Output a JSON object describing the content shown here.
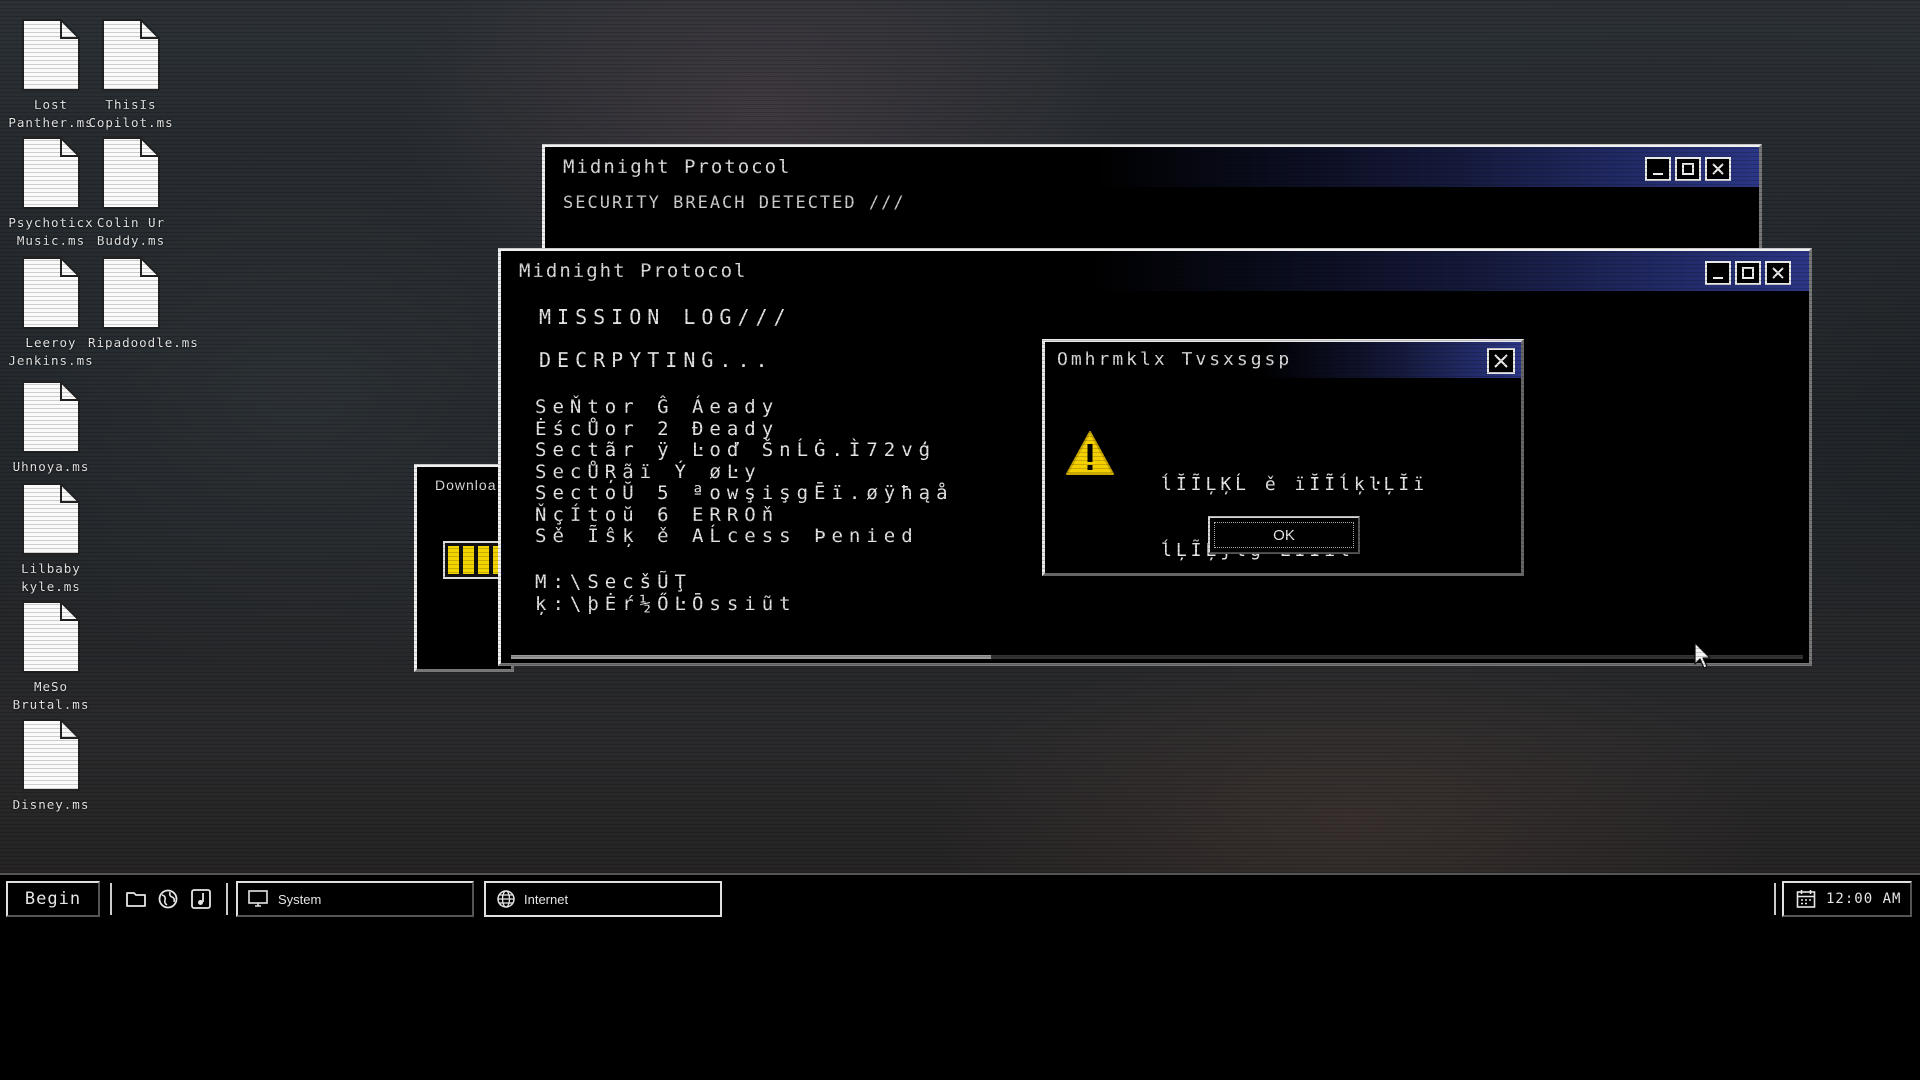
{
  "desktop": {
    "icons": [
      {
        "line1": "Lost",
        "line2": "Panther.ms"
      },
      {
        "line1": "ThisIs",
        "line2": "Copilot.ms"
      },
      {
        "line1": "Psychoticx",
        "line2": "Music.ms"
      },
      {
        "line1": "Colin Ur",
        "line2": "Buddy.ms"
      },
      {
        "line1": "Leeroy",
        "line2": "Jenkins.ms"
      },
      {
        "line1": "",
        "line2": "Ripadoodle.ms"
      },
      {
        "line1": "",
        "line2": "Uhnoya.ms"
      },
      {
        "line1": "Lilbaby",
        "line2": "kyle.ms"
      },
      {
        "line1": "MeSo",
        "line2": "Brutal.ms"
      },
      {
        "line1": "",
        "line2": "Disney.ms"
      }
    ]
  },
  "window_back": {
    "title": "Midnight Protocol",
    "body": "SECURITY BREACH DETECTED ///"
  },
  "window_download": {
    "title": "Downloa"
  },
  "window_front": {
    "title": "Midnight Protocol",
    "heading": "MISSION LOG///",
    "status": "DECRPYTING...",
    "log_lines": [
      "SeŇtor Ĝ Áeady",
      "ĖścŮor 2 Đeady",
      "Sectãr ÿ Ŀoď ŠnĹĠ.Ì72vģ",
      "SecŮŖãï Ý øĿy",
      "SectoŬ 5 ªowşişgĒï.øÿħąå",
      "ŇçÍtoŭ 6 ERROň",
      "Sě Ĩŝķ ě AĹcess Þenied"
    ],
    "path_lines": [
      "M:\\SecšŨŢ",
      "ķ:\\þĖŕ½ŐĿŌssiũt"
    ]
  },
  "dialog": {
    "title": "Omhrmklx Tvsxsgsp",
    "message_line1": "ĺĬĨĻĶĹ ě ïĬĨĺķŀĻĬï",
    "message_line2": "ĺĻĨĻĵĺģ ĹĬĨïŀ",
    "ok_label": "OK",
    "icon": "warning-icon"
  },
  "taskbar": {
    "start_label": "Begin",
    "tasks": [
      {
        "label": "System",
        "icon": "monitor-icon"
      },
      {
        "label": "Internet",
        "icon": "globe-icon"
      }
    ],
    "clock": "12:00 AM"
  },
  "colors": {
    "title_gradient_end": "#2b3685",
    "warning_yellow": "#f5d000",
    "progress_yellow": "#f2d400"
  }
}
